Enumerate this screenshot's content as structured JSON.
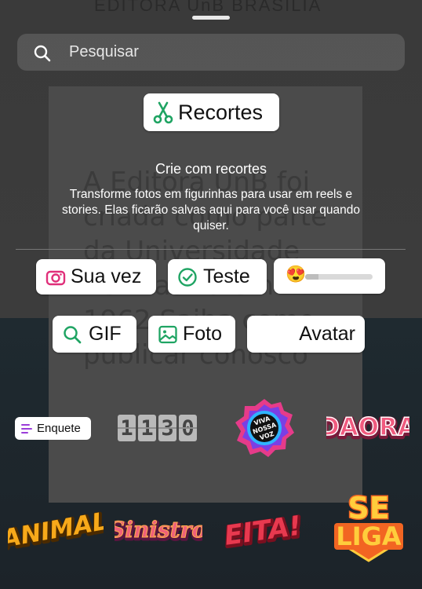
{
  "background": {
    "top_text": "EDITORA UnB BRASILIA",
    "text": "A Editora UnB foi criada como parte da Universidade de Brasília em 1962 Saiba como publicar conosco"
  },
  "search": {
    "placeholder": "Pesquisar",
    "icon": "search-icon"
  },
  "cutouts": {
    "button_label": "Recortes",
    "accent": "#1fa463",
    "title": "Crie com recortes",
    "description": "Transforme fotos em figurinhas para usar em reels e stories. Elas ficarão salvas aqui para você usar quando quiser."
  },
  "stickers": {
    "your_turn": {
      "label": "Sua vez",
      "icon": "camera-icon",
      "color": "#e02f7a"
    },
    "test": {
      "label": "Teste",
      "icon": "check-circle-icon",
      "color": "#1fa463"
    },
    "emoji_slider": {
      "emoji": "😍",
      "value": 0.2
    },
    "gif": {
      "label": "GIF",
      "icon": "search-icon",
      "color": "#1fa463"
    },
    "photo": {
      "label": "Foto",
      "icon": "image-icon",
      "color": "#1fa463"
    },
    "avatar": {
      "label": "Avatar"
    },
    "poll": {
      "label": "Enquete",
      "icon": "list-icon",
      "color": "#9b3dd9"
    },
    "countdown": {
      "digits": [
        "1",
        "1",
        "3",
        "0"
      ]
    },
    "viva_nossa_voz": {
      "text": "VIVA NOSSA VOZ"
    },
    "daora": {
      "text": "DAORA",
      "color": "#f05a7e"
    },
    "animal": {
      "text": "ANIMAL",
      "color": "#f7a91a"
    },
    "sinistro": {
      "text": "Sinistro",
      "color": "#f0607a"
    },
    "eita": {
      "text": "EITA!",
      "color": "#e8394f"
    },
    "se_liga": {
      "line1": "SE",
      "line2": "LIGA",
      "color": "#f26522"
    }
  }
}
